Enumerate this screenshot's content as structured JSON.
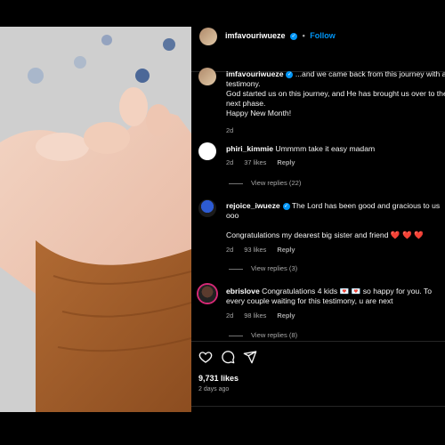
{
  "post": {
    "username": "imfavouriwueze",
    "follow_label": "Follow",
    "separator": "•",
    "caption_user": "imfavouriwueze",
    "caption_lines": [
      "...and we came back from this journey with a",
      "testimony.",
      "God started us on this journey, and He has brought us over to the",
      "next phase.",
      "Happy New Month!"
    ],
    "caption_time": "2d"
  },
  "comments": [
    {
      "user": "phiri_kimmie",
      "text": "Ummmm take it easy madam",
      "time": "2d",
      "likes": "37 likes",
      "reply": "Reply",
      "view_replies": "View replies (22)"
    },
    {
      "user": "rejoice_iwueze",
      "verified": true,
      "text_line1": "The Lord has been good and gracious to us",
      "text_line2": "ooo",
      "text_line3": "Congratulations my dearest big sister and friend ❤️ ❤️ ❤️",
      "time": "2d",
      "likes": "93 likes",
      "reply": "Reply",
      "view_replies": "View replies (3)"
    },
    {
      "user": "ebrislove",
      "text_line1": "Congratulations 4 kids 💌 💌 so happy for you. To",
      "text_line2": "every couple waiting for this testimony, u are next",
      "time": "2d",
      "likes": "98 likes",
      "reply": "Reply",
      "view_replies": "View replies (8)"
    }
  ],
  "actions": {
    "likes": "9,731 likes",
    "posted_ago": "2 days ago"
  },
  "icons": [
    "heart-icon",
    "comment-icon",
    "share-icon",
    "verified-badge-icon"
  ],
  "colors": {
    "accent": "#0095f6",
    "background": "#000000",
    "muted": "#a8a8a8",
    "heart": "#ff3040"
  }
}
